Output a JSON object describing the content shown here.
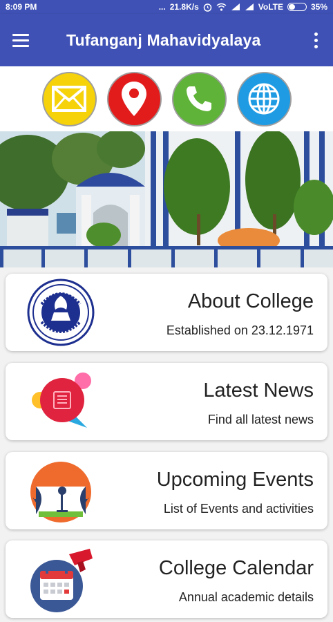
{
  "status_bar": {
    "time": "8:09 PM",
    "dots": "...",
    "speed": "21.8K/s",
    "network": "VoLTE",
    "battery": "35%",
    "battery_level": 0.35
  },
  "app_bar": {
    "title": "Tufanganj Mahavidyalaya",
    "menu_icon": "hamburger-menu-icon",
    "overflow_icon": "more-vert-icon"
  },
  "contact_buttons": [
    {
      "name": "email",
      "icon": "envelope-icon",
      "color": "#f5d20a"
    },
    {
      "name": "location",
      "icon": "location-pin-icon",
      "color": "#e21b1b"
    },
    {
      "name": "phone",
      "icon": "phone-icon",
      "color": "#5fb339"
    },
    {
      "name": "website",
      "icon": "globe-icon",
      "color": "#1e9be3"
    }
  ],
  "cards": [
    {
      "title": "About College",
      "subtitle": "Established on 23.12.1971",
      "icon": "college-seal-icon"
    },
    {
      "title": "Latest News",
      "subtitle": "Find all latest news",
      "icon": "news-bubble-icon"
    },
    {
      "title": "Upcoming Events",
      "subtitle": "List of Events and activities",
      "icon": "stage-microphone-icon"
    },
    {
      "title": "College Calendar",
      "subtitle": "Annual academic details",
      "icon": "calendar-graduation-icon"
    }
  ],
  "colors": {
    "primary": "#3f51b5",
    "background": "#f2f2f2"
  }
}
